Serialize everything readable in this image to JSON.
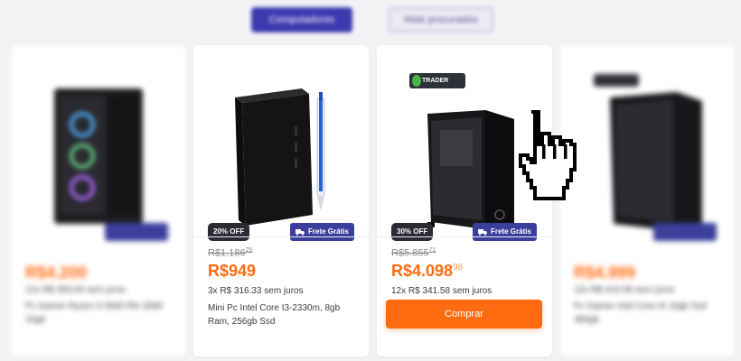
{
  "tabs": [
    {
      "label": "Computadores"
    },
    {
      "label": "Mais procurados"
    }
  ],
  "cards": [
    {
      "price": "R$4.200",
      "installments": "12x R$ 350,00 sem juros",
      "description": "Pc Gamer Ryzen 5 5600 Rtx 3060 16gb"
    },
    {
      "discount": "20% OFF",
      "shipping": "Frete Grátis",
      "old_price": "R$1.186",
      "old_price_cents": "25",
      "price": "R$949",
      "installments": "3x R$ 316.33 sem juros",
      "description": "Mini Pc Intel Core I3-2330m, 8gb Ram, 256gb Ssd"
    },
    {
      "discount": "30% OFF",
      "shipping": "Frete Grátis",
      "old_price": "R$5.855",
      "old_price_cents": "71",
      "price": "R$4.098",
      "price_cents": "98",
      "installments": "12x R$ 341.58 sem juros",
      "buy_label": "Comprar",
      "brand_badge": "TRADER"
    },
    {
      "price": "R$4.999",
      "installments": "12x R$ 416,58 sem juros",
      "description": "Pc Gamer Intel Core i5 16gb Ssd 480gb"
    }
  ],
  "colors": {
    "accent": "#ff6b10",
    "primary": "#3b3f9c",
    "dark_badge": "#2b2b33"
  }
}
